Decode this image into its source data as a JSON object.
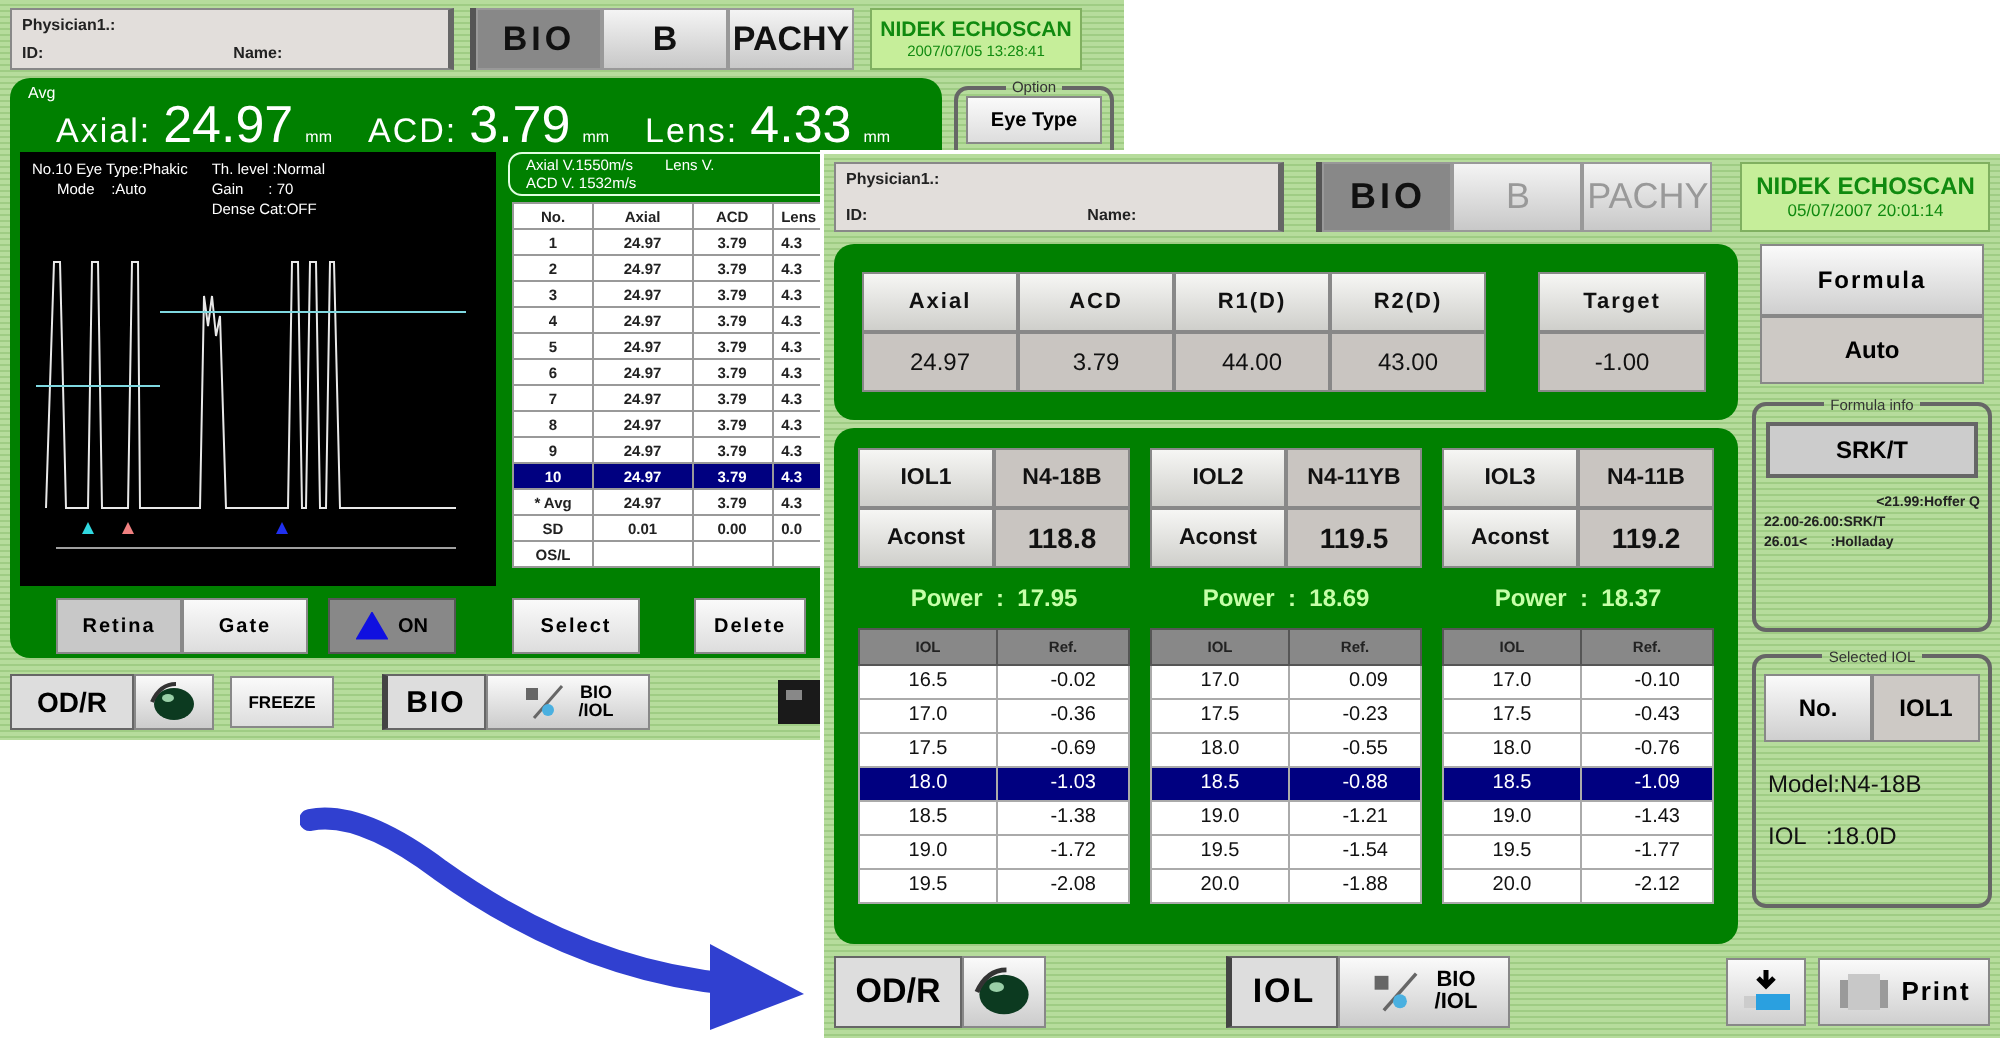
{
  "measurement_screen": {
    "patient": {
      "physician_label": "Physician1.:",
      "id_label": "ID:",
      "name_label": "Name:"
    },
    "mode_tabs": [
      {
        "label": "BIO",
        "selected": true,
        "disabled": false
      },
      {
        "label": "B",
        "selected": false,
        "disabled": false
      },
      {
        "label": "PACHY",
        "selected": false,
        "disabled": false
      }
    ],
    "brand": "NIDEK ECHOSCAN",
    "datetime": "2007/07/05 13:28:41",
    "option": {
      "legend": "Option",
      "button": "Eye Type"
    },
    "avg_label": "Avg",
    "readings": [
      {
        "label": "Axial:",
        "value": "24.97",
        "unit": "mm"
      },
      {
        "label": "ACD:",
        "value": "3.79",
        "unit": "mm"
      },
      {
        "label": "Lens:",
        "value": "4.33",
        "unit": "mm"
      }
    ],
    "waveform_info": {
      "left": [
        "No.10 Eye Type:Phakic",
        "      Mode    :Auto"
      ],
      "right": [
        "Th. level :Normal",
        "Gain      : 70",
        "Dense Cat:OFF"
      ]
    },
    "velocities": {
      "axial": "Axial V.1550m/s",
      "lens": "Lens V.",
      "acd": "ACD V.   1532m/s"
    },
    "table": {
      "columns": [
        "No.",
        "Axial",
        "ACD",
        "Lens"
      ],
      "rows": [
        {
          "cells": [
            "1",
            "24.97",
            "3.79",
            "4.3"
          ],
          "selected": false
        },
        {
          "cells": [
            "2",
            "24.97",
            "3.79",
            "4.3"
          ],
          "selected": false
        },
        {
          "cells": [
            "3",
            "24.97",
            "3.79",
            "4.3"
          ],
          "selected": false
        },
        {
          "cells": [
            "4",
            "24.97",
            "3.79",
            "4.3"
          ],
          "selected": false
        },
        {
          "cells": [
            "5",
            "24.97",
            "3.79",
            "4.3"
          ],
          "selected": false
        },
        {
          "cells": [
            "6",
            "24.97",
            "3.79",
            "4.3"
          ],
          "selected": false
        },
        {
          "cells": [
            "7",
            "24.97",
            "3.79",
            "4.3"
          ],
          "selected": false
        },
        {
          "cells": [
            "8",
            "24.97",
            "3.79",
            "4.3"
          ],
          "selected": false
        },
        {
          "cells": [
            "9",
            "24.97",
            "3.79",
            "4.3"
          ],
          "selected": false
        },
        {
          "cells": [
            "10",
            "24.97",
            "3.79",
            "4.3"
          ],
          "selected": true
        },
        {
          "cells": [
            "* Avg",
            "24.97",
            "3.79",
            "4.3"
          ],
          "selected": false
        },
        {
          "cells": [
            "SD",
            "0.01",
            "0.00",
            "0.0"
          ],
          "selected": false
        },
        {
          "cells": [
            "OS/L"
          ],
          "selected": false
        }
      ]
    },
    "gate_modes": [
      {
        "label": "Retina",
        "selected": true
      },
      {
        "label": "Gate",
        "selected": false
      }
    ],
    "marker_toggle": {
      "label": "ON",
      "on": true
    },
    "actions": [
      "Select",
      "Delete"
    ],
    "bottom": {
      "eye_button": "OD/R",
      "freeze": "FREEZE",
      "mode": "BIO",
      "switch": [
        "BIO",
        "/IOL"
      ]
    }
  },
  "iol_screen": {
    "patient": {
      "physician_label": "Physician1.:",
      "id_label": "ID:",
      "name_label": "Name:"
    },
    "mode_tabs": [
      {
        "label": "BIO",
        "selected": true,
        "disabled": false
      },
      {
        "label": "B",
        "selected": false,
        "disabled": true
      },
      {
        "label": "PACHY",
        "selected": false,
        "disabled": true
      }
    ],
    "brand": "NIDEK ECHOSCAN",
    "datetime": "05/07/2007 20:01:14",
    "biometry": {
      "columns": [
        "Axial",
        "ACD",
        "R1(D)",
        "R2(D)"
      ],
      "values": [
        "24.97",
        "3.79",
        "44.00",
        "43.00"
      ]
    },
    "target": {
      "label": "Target",
      "value": "-1.00"
    },
    "formula": {
      "label": "Formula",
      "value": "Auto"
    },
    "formula_info": {
      "legend": "Formula info",
      "formula": "SRK/T",
      "ranges": [
        "<21.99:Hoffer Q",
        "22.00-26.00:SRK/T",
        "26.01<      :Holladay"
      ]
    },
    "iols": [
      {
        "name": "IOL1",
        "model": "N4-18B",
        "aconst_label": "Aconst",
        "aconst": "118.8",
        "power": "Power  :  17.95",
        "columns": [
          "IOL",
          "Ref."
        ],
        "rows": [
          {
            "iol": "16.5",
            "ref": "-0.02",
            "selected": false
          },
          {
            "iol": "17.0",
            "ref": "-0.36",
            "selected": false
          },
          {
            "iol": "17.5",
            "ref": "-0.69",
            "selected": false
          },
          {
            "iol": "18.0",
            "ref": "-1.03",
            "selected": true
          },
          {
            "iol": "18.5",
            "ref": "-1.38",
            "selected": false
          },
          {
            "iol": "19.0",
            "ref": "-1.72",
            "selected": false
          },
          {
            "iol": "19.5",
            "ref": "-2.08",
            "selected": false
          }
        ]
      },
      {
        "name": "IOL2",
        "model": "N4-11YB",
        "aconst_label": "Aconst",
        "aconst": "119.5",
        "power": "Power  :  18.69",
        "columns": [
          "IOL",
          "Ref."
        ],
        "rows": [
          {
            "iol": "17.0",
            "ref": "0.09",
            "selected": false
          },
          {
            "iol": "17.5",
            "ref": "-0.23",
            "selected": false
          },
          {
            "iol": "18.0",
            "ref": "-0.55",
            "selected": false
          },
          {
            "iol": "18.5",
            "ref": "-0.88",
            "selected": true
          },
          {
            "iol": "19.0",
            "ref": "-1.21",
            "selected": false
          },
          {
            "iol": "19.5",
            "ref": "-1.54",
            "selected": false
          },
          {
            "iol": "20.0",
            "ref": "-1.88",
            "selected": false
          }
        ]
      },
      {
        "name": "IOL3",
        "model": "N4-11B",
        "aconst_label": "Aconst",
        "aconst": "119.2",
        "power": "Power  :  18.37",
        "columns": [
          "IOL",
          "Ref."
        ],
        "rows": [
          {
            "iol": "17.0",
            "ref": "-0.10",
            "selected": false
          },
          {
            "iol": "17.5",
            "ref": "-0.43",
            "selected": false
          },
          {
            "iol": "18.0",
            "ref": "-0.76",
            "selected": false
          },
          {
            "iol": "18.5",
            "ref": "-1.09",
            "selected": true
          },
          {
            "iol": "19.0",
            "ref": "-1.43",
            "selected": false
          },
          {
            "iol": "19.5",
            "ref": "-1.77",
            "selected": false
          },
          {
            "iol": "20.0",
            "ref": "-2.12",
            "selected": false
          }
        ]
      }
    ],
    "selected_iol": {
      "legend": "Selected IOL",
      "no_label": "No.",
      "value": "IOL1",
      "model": "Model:N4-18B",
      "power": "IOL   :18.0D"
    },
    "bottom": {
      "eye_button": "OD/R",
      "mode": "IOL",
      "switch": [
        "BIO",
        "/IOL"
      ],
      "print": "Print"
    }
  }
}
